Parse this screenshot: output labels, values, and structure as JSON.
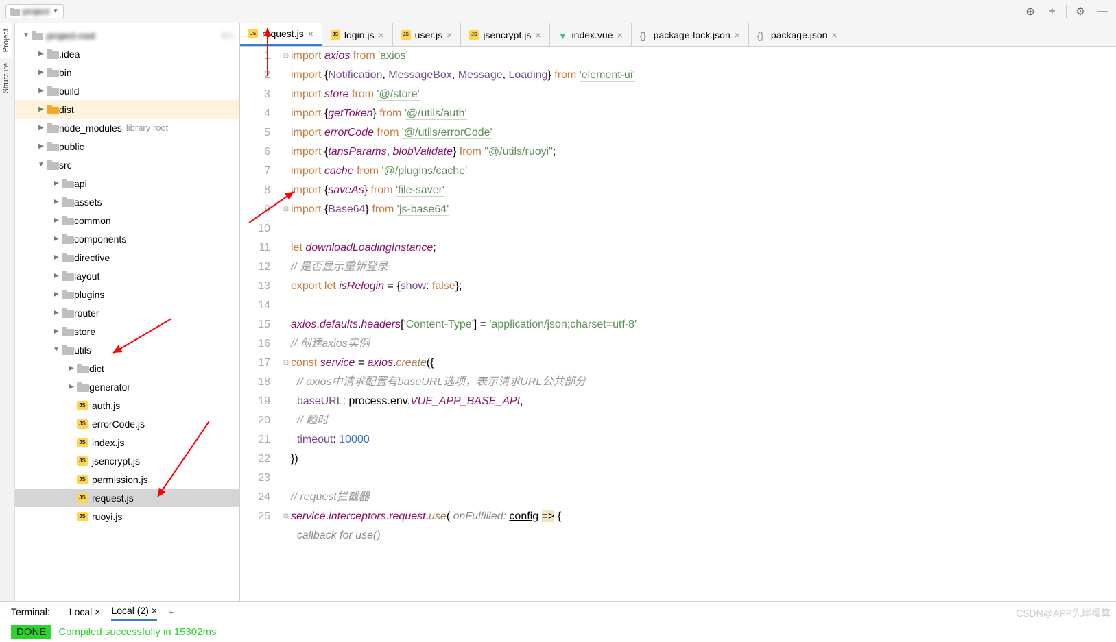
{
  "toolbar": {
    "proj_name": "project"
  },
  "sidebar": {
    "vtabs": [
      "Project",
      "Structure"
    ],
    "items": [
      {
        "label": ".idea",
        "type": "folder",
        "indent": 1,
        "expand": "▶"
      },
      {
        "label": "bin",
        "type": "folder",
        "indent": 1,
        "expand": "▶"
      },
      {
        "label": "build",
        "type": "folder",
        "indent": 1,
        "expand": "▶"
      },
      {
        "label": "dist",
        "type": "folder",
        "indent": 1,
        "expand": "▶",
        "highlight": true,
        "orange": true
      },
      {
        "label": "node_modules",
        "type": "folder",
        "indent": 1,
        "expand": "▶",
        "note": "library root"
      },
      {
        "label": "public",
        "type": "folder",
        "indent": 1,
        "expand": "▶"
      },
      {
        "label": "src",
        "type": "folder",
        "indent": 1,
        "expand": "▼"
      },
      {
        "label": "api",
        "type": "folder",
        "indent": 2,
        "expand": "▶"
      },
      {
        "label": "assets",
        "type": "folder",
        "indent": 2,
        "expand": "▶"
      },
      {
        "label": "common",
        "type": "folder",
        "indent": 2,
        "expand": "▶"
      },
      {
        "label": "components",
        "type": "folder",
        "indent": 2,
        "expand": "▶"
      },
      {
        "label": "directive",
        "type": "folder",
        "indent": 2,
        "expand": "▶"
      },
      {
        "label": "layout",
        "type": "folder",
        "indent": 2,
        "expand": "▶"
      },
      {
        "label": "plugins",
        "type": "folder",
        "indent": 2,
        "expand": "▶"
      },
      {
        "label": "router",
        "type": "folder",
        "indent": 2,
        "expand": "▶"
      },
      {
        "label": "store",
        "type": "folder",
        "indent": 2,
        "expand": "▶"
      },
      {
        "label": "utils",
        "type": "folder",
        "indent": 2,
        "expand": "▼"
      },
      {
        "label": "dict",
        "type": "folder",
        "indent": 3,
        "expand": "▶"
      },
      {
        "label": "generator",
        "type": "folder",
        "indent": 3,
        "expand": "▶"
      },
      {
        "label": "auth.js",
        "type": "js",
        "indent": 3
      },
      {
        "label": "errorCode.js",
        "type": "js",
        "indent": 3
      },
      {
        "label": "index.js",
        "type": "js",
        "indent": 3
      },
      {
        "label": "jsencrypt.js",
        "type": "js",
        "indent": 3
      },
      {
        "label": "permission.js",
        "type": "js",
        "indent": 3
      },
      {
        "label": "request.js",
        "type": "js",
        "indent": 3,
        "selected": true
      },
      {
        "label": "ruoyi.js",
        "type": "js",
        "indent": 3
      }
    ]
  },
  "tabs": [
    {
      "label": "request.js",
      "type": "js",
      "active": true
    },
    {
      "label": "login.js",
      "type": "js"
    },
    {
      "label": "user.js",
      "type": "js"
    },
    {
      "label": "jsencrypt.js",
      "type": "js"
    },
    {
      "label": "index.vue",
      "type": "vue"
    },
    {
      "label": "package-lock.json",
      "type": "json"
    },
    {
      "label": "package.json",
      "type": "json"
    }
  ],
  "code": {
    "lines": [
      "1",
      "2",
      "3",
      "4",
      "5",
      "6",
      "7",
      "8",
      "9",
      "10",
      "11",
      "12",
      "13",
      "14",
      "15",
      "16",
      "17",
      "18",
      "19",
      "20",
      "21",
      "22",
      "23",
      "24",
      "25",
      ""
    ],
    "hint": "callback for use()"
  },
  "terminal": {
    "title": "Terminal:",
    "tabs": [
      "Local",
      "Local (2)"
    ],
    "done": "DONE",
    "msg": "Compiled successfully in 15302ms"
  },
  "watermark": "CSDN@APP先崖樱算"
}
